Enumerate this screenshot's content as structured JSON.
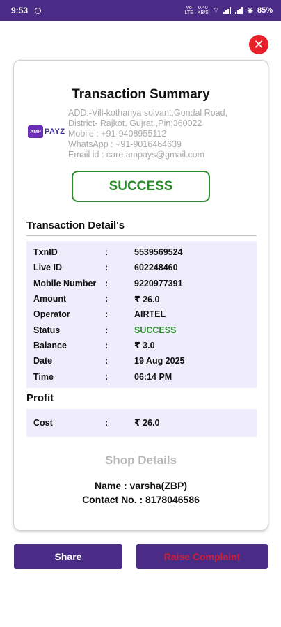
{
  "statusbar": {
    "time": "9:53",
    "network": "Vo\nLTE",
    "speed": "0.40\nKB/S",
    "battery": "85%"
  },
  "close_symbol": "✕",
  "summary": {
    "title": "Transaction Summary",
    "logo_mark": "AMP",
    "logo_word": "PAYZ",
    "address_lines": [
      "ADD:-Vill-kothariya solvant,Gondal Road,",
      "District- Rajkot, Gujrat ,Pin:360022",
      "Mobile : +91-9408955112",
      "WhatsApp : +91-9016464639",
      "Email id : care.ampays@gmail.com"
    ],
    "status": "SUCCESS"
  },
  "transaction_detail": {
    "title": "Transaction Detail's",
    "rows": [
      {
        "label": "TxnID",
        "sep": ":",
        "value": "5539569524"
      },
      {
        "label": "Live ID",
        "sep": ":",
        "value": "602248460"
      },
      {
        "label": "Mobile Number",
        "sep": ":",
        "value": "9220977391"
      },
      {
        "label": "Amount",
        "sep": ":",
        "value": "₹ 26.0"
      },
      {
        "label": "Operator",
        "sep": ":",
        "value": "AIRTEL"
      },
      {
        "label": "Status",
        "sep": ":",
        "value": "SUCCESS"
      },
      {
        "label": "Balance",
        "sep": ":",
        "value": "₹ 3.0"
      },
      {
        "label": "Date",
        "sep": ":",
        "value": "19 Aug 2025"
      },
      {
        "label": "Time",
        "sep": ":",
        "value": "06:14 PM"
      }
    ]
  },
  "profit": {
    "title": "Profit",
    "rows": [
      {
        "label": "Cost",
        "sep": ":",
        "value": "₹ 26.0"
      }
    ]
  },
  "shop": {
    "title": "Shop Details",
    "name_line": "Name  :  varsha(ZBP)",
    "contact_line": "Contact No.  :  8178046586"
  },
  "buttons": {
    "share": "Share",
    "complaint": "Raise Complaint"
  },
  "colors": {
    "primary": "#4a2b86",
    "success": "#2d8b2d",
    "close": "#e8202a",
    "detail_bg": "#efedfb",
    "complaint_text": "#cc1f3a"
  }
}
